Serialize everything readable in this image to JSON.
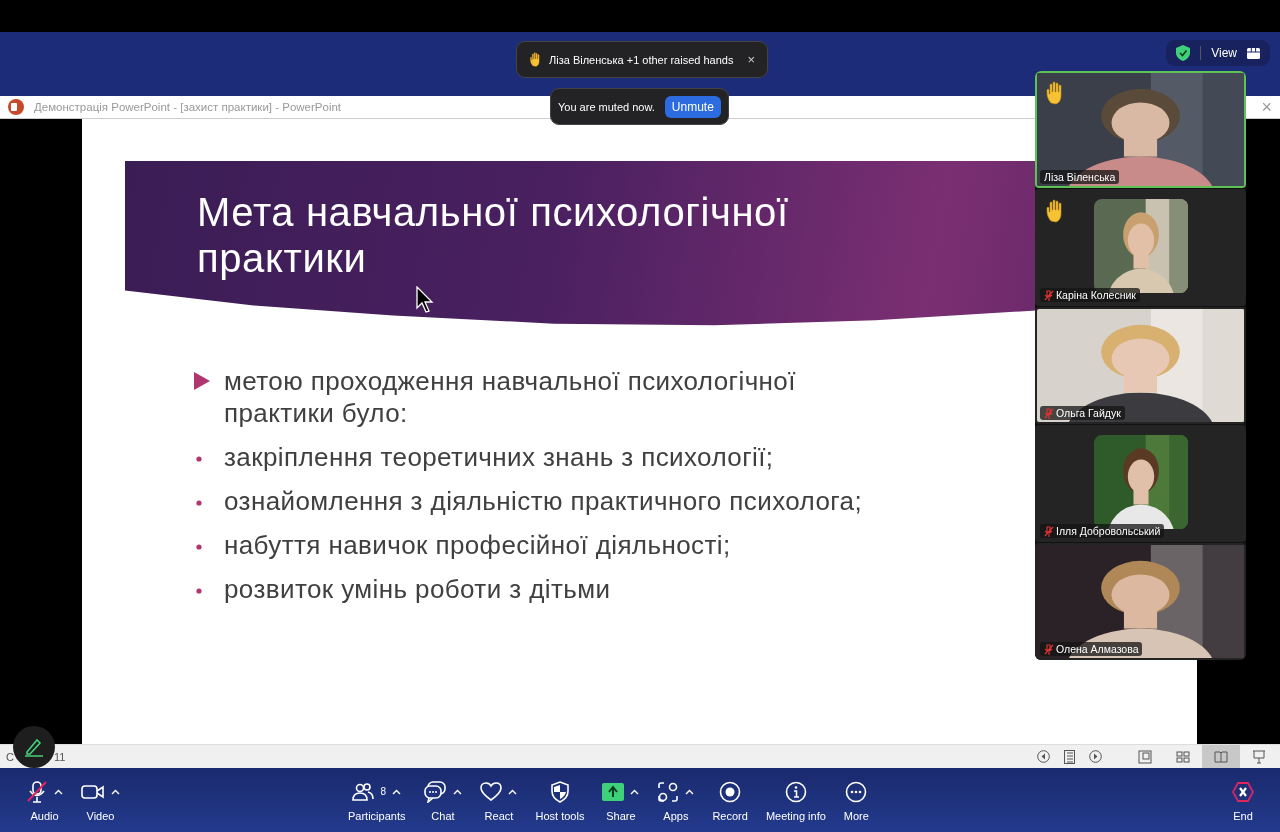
{
  "top_bar": {
    "view_label": "View"
  },
  "notifications": {
    "raised_hands": {
      "text": "Ліза Віленська +1 other raised hands",
      "close": "×"
    },
    "muted": {
      "message": "You are muted now.",
      "button": "Unmute"
    }
  },
  "powerpoint": {
    "window_title": "Демонстрація PowerPoint - [захист практики] - PowerPoint",
    "close": "×",
    "slide": {
      "title": "Мета навчальної психологічної практики",
      "bullets": [
        {
          "kind": "arrow",
          "text": "метою проходження навчальної психологічної практики було:"
        },
        {
          "kind": "dot",
          "text": "закріплення теоретичних знань з психології;"
        },
        {
          "kind": "dot",
          "text": "ознайомлення з діяльністю практичного психолога;"
        },
        {
          "kind": "dot",
          "text": "набуття навичок професійної діяльності;"
        },
        {
          "kind": "dot",
          "text": "розвиток умінь роботи з дітьми"
        }
      ]
    },
    "status_text": [
      "С",
      "11"
    ],
    "view_buttons": [
      {
        "kind": "normal",
        "selected": false
      },
      {
        "kind": "sorter",
        "selected": false
      },
      {
        "kind": "reading",
        "selected": true
      },
      {
        "kind": "slideshow",
        "selected": false
      }
    ]
  },
  "participants": [
    {
      "name": "Ліза Віленська",
      "kind": "full",
      "hand_raised": true,
      "muted": false,
      "active_speaker": true
    },
    {
      "name": "Каріна Колесник",
      "kind": "square",
      "hand_raised": true,
      "muted": true,
      "active_speaker": false
    },
    {
      "name": "Ольга Гайдук",
      "kind": "full",
      "hand_raised": false,
      "muted": true,
      "active_speaker": false
    },
    {
      "name": "Ілля Добровольський",
      "kind": "square",
      "hand_raised": false,
      "muted": true,
      "active_speaker": false
    },
    {
      "name": "Олена Алмазова",
      "kind": "full",
      "hand_raised": false,
      "muted": true,
      "active_speaker": false
    }
  ],
  "toolbar": {
    "items": [
      {
        "kind": "mic",
        "label": "Audio",
        "has_menu": true,
        "muted": true
      },
      {
        "kind": "video",
        "label": "Video",
        "has_menu": true,
        "muted": false
      },
      {
        "kind": "participants",
        "label": "Participants",
        "count": "8",
        "has_menu": true,
        "muted": false
      },
      {
        "kind": "chat",
        "label": "Chat",
        "has_menu": true,
        "muted": false
      },
      {
        "kind": "react",
        "label": "React",
        "has_menu": true,
        "muted": false
      },
      {
        "kind": "host",
        "label": "Host tools",
        "has_menu": false,
        "muted": false
      },
      {
        "kind": "share",
        "label": "Share",
        "has_menu": true,
        "muted": false
      },
      {
        "kind": "apps",
        "label": "Apps",
        "has_menu": true,
        "muted": false
      },
      {
        "kind": "record",
        "label": "Record",
        "has_menu": false,
        "muted": false
      },
      {
        "kind": "info",
        "label": "Meeting info",
        "has_menu": false,
        "muted": false
      },
      {
        "kind": "more",
        "label": "More",
        "has_menu": false,
        "muted": false
      }
    ],
    "end_label": "End"
  }
}
